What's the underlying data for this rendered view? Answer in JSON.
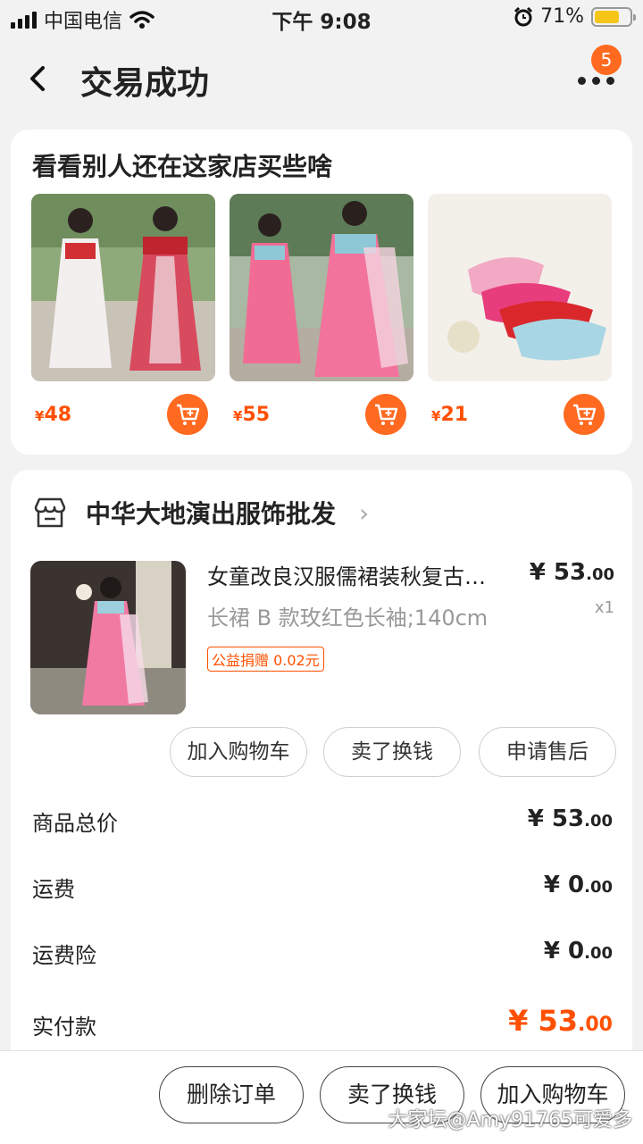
{
  "status": {
    "carrier": "中国电信",
    "time": "下午 9:08",
    "battery": "71%"
  },
  "nav": {
    "back_icon": "chevron-left-icon",
    "title": "交易成功",
    "badge": "5"
  },
  "recommend": {
    "title": "看看别人还在这家店买些啥",
    "currency": "¥",
    "items": [
      {
        "price": "48"
      },
      {
        "price": "55"
      },
      {
        "price": "21"
      }
    ]
  },
  "order": {
    "shop_name": "中华大地演出服饰批发",
    "product": {
      "title": "女童改良汉服儒裙装秋复古中国风",
      "spec": "长裙 B 款玫红色长袖;140cm",
      "tag": "公益捐赠 0.02元",
      "price_int": "¥ 53",
      "price_dec": ".00",
      "qty": "x1"
    },
    "actions": {
      "add_cart": "加入购物车",
      "resell": "卖了换钱",
      "after_sale": "申请售后"
    },
    "summary": {
      "goods_label": "商品总价",
      "goods_int": "¥ 53",
      "goods_dec": ".00",
      "ship_label": "运费",
      "ship_int": "¥ 0",
      "ship_dec": ".00",
      "insure_label": "运费险",
      "insure_int": "¥ 0",
      "insure_dec": ".00",
      "paid_label": "实付款",
      "paid_int": "¥ 53",
      "paid_dec": ".00"
    }
  },
  "bottom": {
    "delete": "删除订单",
    "resell": "卖了换钱",
    "add_cart": "加入购物车"
  },
  "watermark": "大家坛@Amy91765可爱多",
  "colors": {
    "accent": "#ff5000",
    "cart_button": "#ff6a20"
  }
}
